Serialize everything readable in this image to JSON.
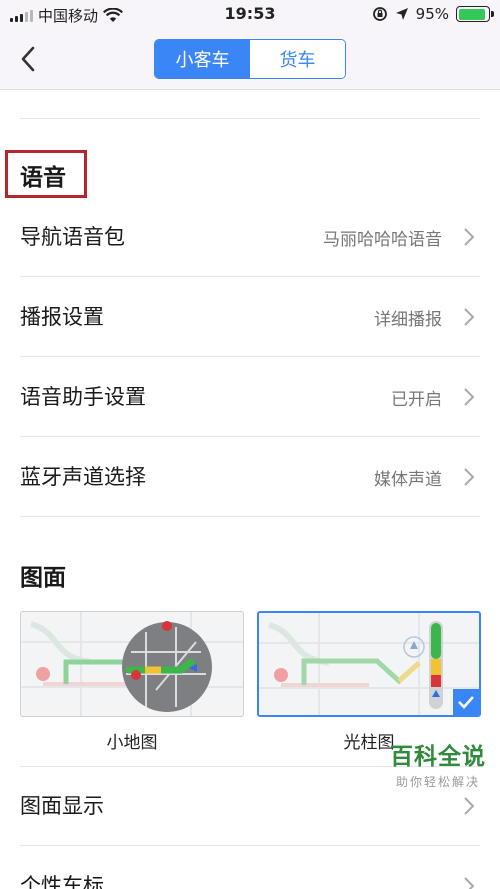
{
  "status_bar": {
    "carrier": "中国移动",
    "time": "19:53",
    "battery": "95%",
    "battery_level": 0.95
  },
  "header": {
    "back_icon": "chevron-left-icon",
    "tabs": [
      {
        "label": "小客车",
        "active": true
      },
      {
        "label": "货车",
        "active": false
      }
    ],
    "accent": "#3b86f7"
  },
  "voice": {
    "title": "语音",
    "highlight_color": "#b5262c",
    "items": [
      {
        "label": "导航语音包",
        "value": "马丽哈哈哈语音"
      },
      {
        "label": "播报设置",
        "value": "详细播报"
      },
      {
        "label": "语音助手设置",
        "value": "已开启"
      },
      {
        "label": "蓝牙声道选择",
        "value": "媒体声道"
      }
    ]
  },
  "display": {
    "title": "图面",
    "options": [
      {
        "label": "小地图",
        "selected": false
      },
      {
        "label": "光柱图",
        "selected": true
      }
    ],
    "items": [
      {
        "label": "图面显示"
      },
      {
        "label": "个性车标"
      }
    ]
  },
  "watermark": {
    "title": "百科全说",
    "subtitle": "助你轻松解决"
  }
}
